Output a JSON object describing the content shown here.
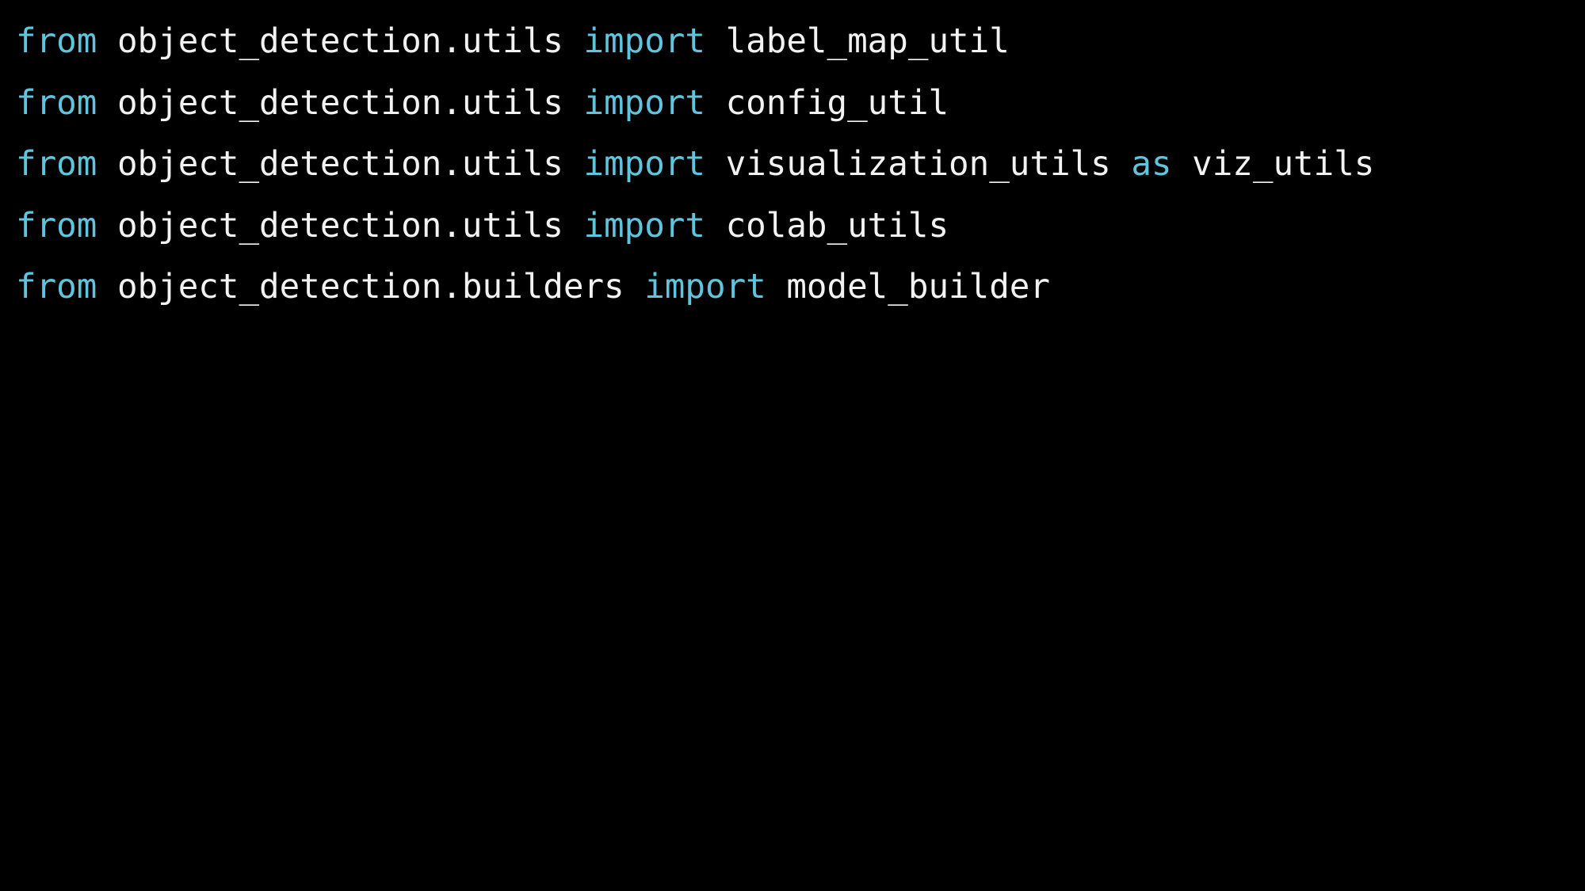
{
  "colors": {
    "background": "#000000",
    "keyword": "#5fc4dc",
    "text": "#f2f2f2"
  },
  "code": {
    "lines": [
      [
        {
          "t": "from",
          "kw": true
        },
        {
          "t": " object_detection.utils ",
          "kw": false
        },
        {
          "t": "import",
          "kw": true
        },
        {
          "t": " label_map_util",
          "kw": false
        }
      ],
      [
        {
          "t": "from",
          "kw": true
        },
        {
          "t": " object_detection.utils ",
          "kw": false
        },
        {
          "t": "import",
          "kw": true
        },
        {
          "t": " config_util",
          "kw": false
        }
      ],
      [
        {
          "t": "from",
          "kw": true
        },
        {
          "t": " object_detection.utils ",
          "kw": false
        },
        {
          "t": "import",
          "kw": true
        },
        {
          "t": " visualization_utils ",
          "kw": false
        },
        {
          "t": "as",
          "kw": true
        },
        {
          "t": " viz_utils",
          "kw": false
        }
      ],
      [
        {
          "t": "from",
          "kw": true
        },
        {
          "t": " object_detection.utils ",
          "kw": false
        },
        {
          "t": "import",
          "kw": true
        },
        {
          "t": " colab_utils",
          "kw": false
        }
      ],
      [
        {
          "t": "from",
          "kw": true
        },
        {
          "t": " object_detection.builders ",
          "kw": false
        },
        {
          "t": "import",
          "kw": true
        },
        {
          "t": " model_builder",
          "kw": false
        }
      ]
    ]
  }
}
